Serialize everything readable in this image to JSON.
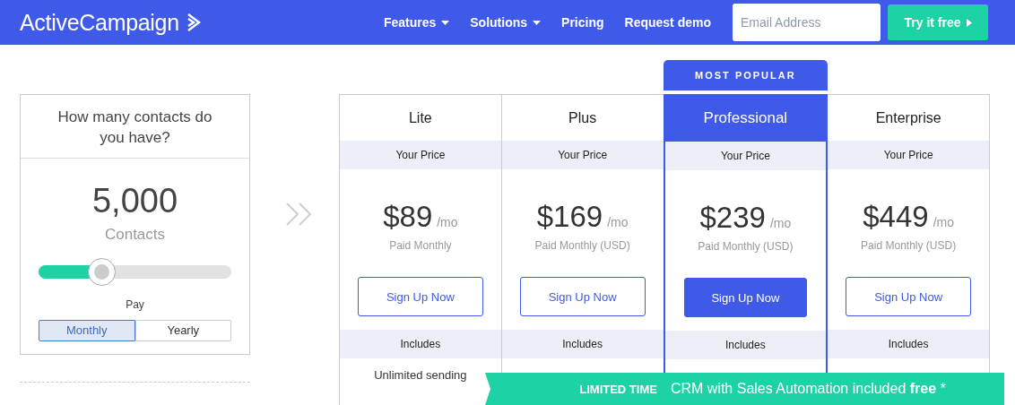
{
  "nav": {
    "logo": "ActiveCampaign",
    "links": [
      {
        "label": "Features",
        "dropdown": true
      },
      {
        "label": "Solutions",
        "dropdown": true
      },
      {
        "label": "Pricing",
        "dropdown": false
      },
      {
        "label": "Request demo",
        "dropdown": false
      }
    ],
    "email": {
      "placeholder": "Email Address"
    },
    "cta": "Try it free"
  },
  "contacts": {
    "question": "How many contacts do you have?",
    "count": "5,000",
    "unit": "Contacts",
    "slider": {
      "level": 0.33
    },
    "pay_label": "Pay",
    "billing": [
      {
        "label": "Monthly",
        "selected": true
      },
      {
        "label": "Yearly",
        "selected": false
      }
    ]
  },
  "plans": [
    {
      "name": "Lite",
      "featured": false,
      "price_label": "Your Price",
      "price": "$89",
      "per": "/mo",
      "billing": "Paid Monthly",
      "button": "Sign Up Now",
      "includes": "Includes",
      "features": [
        "Unlimited sending"
      ]
    },
    {
      "name": "Plus",
      "featured": false,
      "price_label": "Your Price",
      "price": "$169",
      "per": "/mo",
      "billing": "Paid Monthly (USD)",
      "button": "Sign Up Now",
      "includes": "Includes"
    },
    {
      "name": "Professional",
      "featured": true,
      "badge": "MOST POPULAR",
      "price_label": "Your Price",
      "price": "$239",
      "per": "/mo",
      "billing": "Paid Monthly (USD)",
      "button": "Sign Up Now",
      "includes": "Includes"
    },
    {
      "name": "Enterprise",
      "featured": false,
      "price_label": "Your Price",
      "price": "$449",
      "per": "/mo",
      "billing": "Paid Monthly (USD)",
      "button": "Sign Up Now",
      "includes": "Includes"
    }
  ],
  "banner": {
    "label": "LIMITED TIME",
    "text": "CRM with Sales Automation included **free** *"
  }
}
